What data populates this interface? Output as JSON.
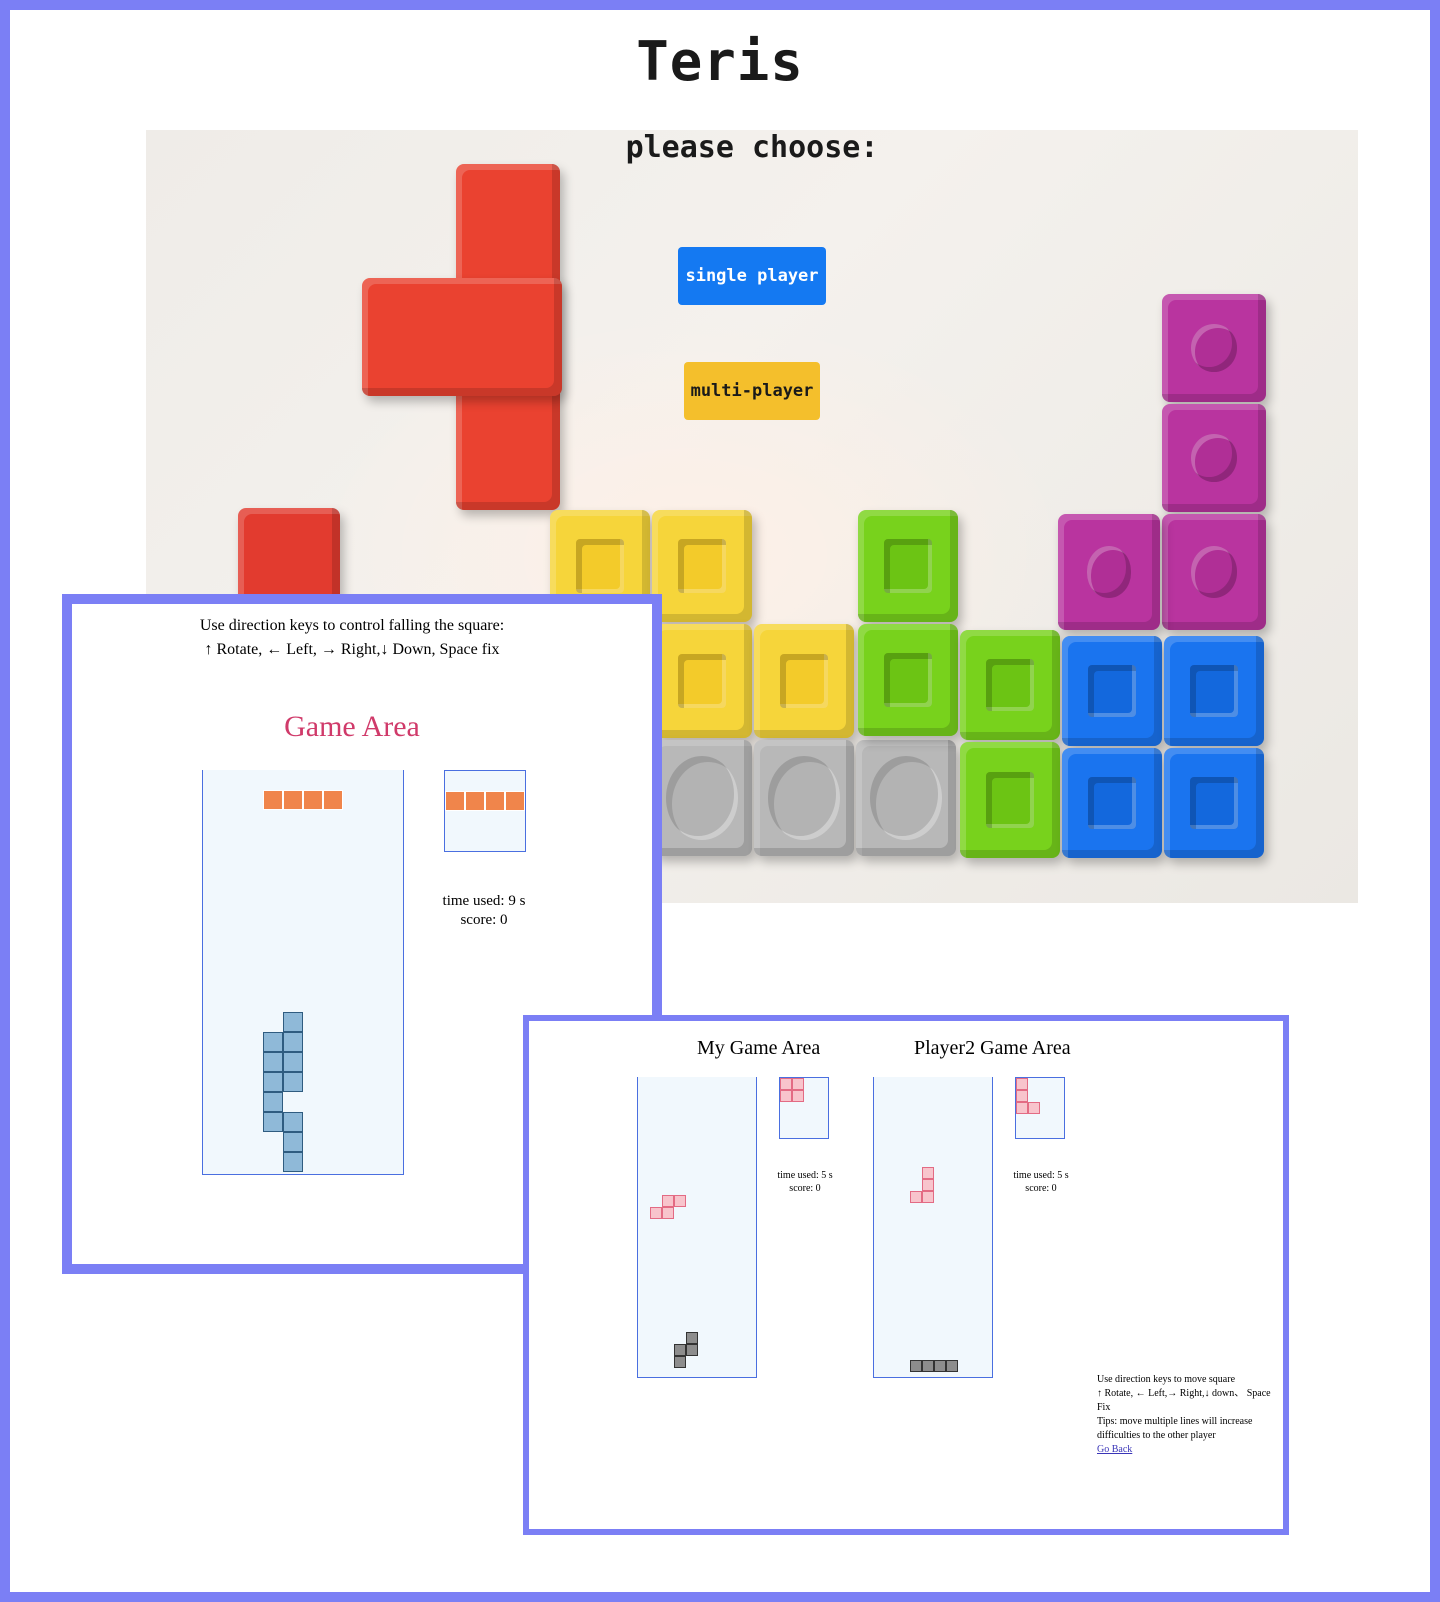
{
  "app": {
    "title": "Teris"
  },
  "menu": {
    "prompt": "please choose:",
    "single_label": "single player",
    "multi_label": "multi-player"
  },
  "single": {
    "instr_line1": "Use direction keys to control falling the square:",
    "instr_line2": "↑ Rotate, ← Left, → Right,↓ Down, Space fix",
    "area_title": "Game Area",
    "time_used": "time used: 9 s",
    "score": "score: 0"
  },
  "multi": {
    "my_area_title": "My Game Area",
    "p2_area_title": "Player2 Game Area",
    "my_time_used": "time used: 5 s",
    "my_score": "score: 0",
    "p2_time_used": "time used: 5 s",
    "p2_score": "score: 0",
    "help_line1": "Use direction keys to move square",
    "help_line2": "↑ Rotate, ← Left,→ Right,↓ down、 Space Fix",
    "help_line3": "Tips: move multiple lines will increase difficulties to the other player",
    "go_back": "Go Back"
  },
  "colors": {
    "border": "#7b7ff5",
    "single_button": "#1479f2",
    "multi_button": "#f4bf2c",
    "game_area_title": "#d03a6a",
    "falling_piece": "#f0854b",
    "stacked_piece": "#8fb9d8",
    "pink_piece": "#f8c4cc",
    "gray_piece": "#8d8d8d"
  }
}
